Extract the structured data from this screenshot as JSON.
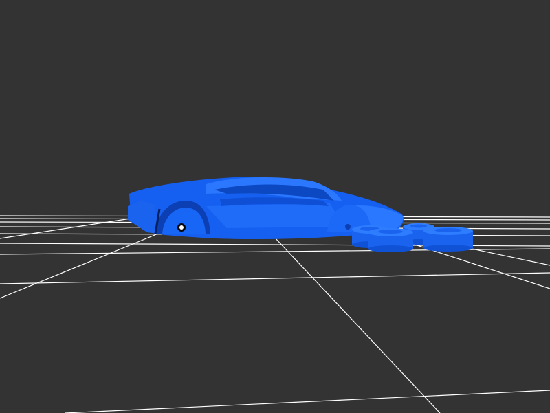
{
  "viewport": {
    "background_color": "#333333",
    "grid_color": "#ffffff",
    "model_color": "#1a66ff",
    "model_shadow_color": "#0b3fb3",
    "model_highlight_color": "#3d86ff",
    "object_name": "car-body",
    "detached_parts": "wheels"
  }
}
